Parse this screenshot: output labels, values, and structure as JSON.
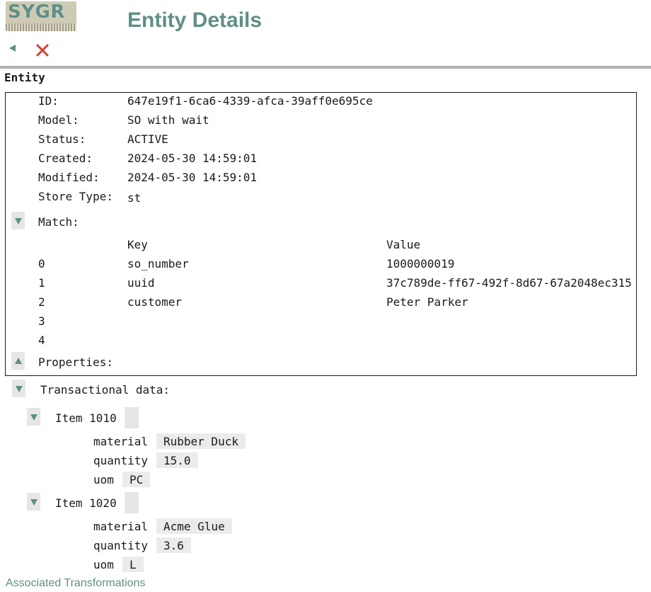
{
  "header": {
    "logo_text": "SYGR",
    "title": "Entity Details",
    "back_icon": "back-triangle-icon",
    "close_icon": "close-x-icon",
    "accent_color": "#5f8f87",
    "close_color": "#e03c31"
  },
  "entity": {
    "section_title": "Entity",
    "fields": [
      {
        "label": "ID:",
        "value": "647e19f1-6ca6-4339-afca-39aff0e695ce"
      },
      {
        "label": "Model:",
        "value": "SO with wait"
      },
      {
        "label": "Status:",
        "value": "ACTIVE"
      },
      {
        "label": "Created:",
        "value": "2024-05-30 14:59:01"
      },
      {
        "label": "Modified:",
        "value": "2024-05-30 14:59:01"
      },
      {
        "label": "Store Type:",
        "value": "st"
      }
    ],
    "match": {
      "label": "Match:",
      "columns": {
        "key": "Key",
        "value": "Value"
      },
      "rows": [
        {
          "index": "0",
          "key": "so_number",
          "value": "1000000019"
        },
        {
          "index": "1",
          "key": "uuid",
          "value": "37c789de-ff67-492f-8d67-67a2048ec315"
        },
        {
          "index": "2",
          "key": "customer",
          "value": "Peter Parker"
        },
        {
          "index": "3",
          "key": "",
          "value": ""
        },
        {
          "index": "4",
          "key": "",
          "value": ""
        }
      ]
    },
    "properties_label": "Properties:"
  },
  "transactional": {
    "label": "Transactional data:",
    "items": [
      {
        "title": "Item 1010",
        "fields": [
          {
            "name": "material",
            "value": "Rubber Duck"
          },
          {
            "name": "quantity",
            "value": "15.0"
          },
          {
            "name": "uom",
            "value": "PC"
          }
        ]
      },
      {
        "title": "Item 1020",
        "fields": [
          {
            "name": "material",
            "value": "Acme Glue"
          },
          {
            "name": "quantity",
            "value": "3.6"
          },
          {
            "name": "uom",
            "value": "L"
          }
        ]
      }
    ]
  },
  "footer": {
    "link_text": "Associated Transformations"
  }
}
